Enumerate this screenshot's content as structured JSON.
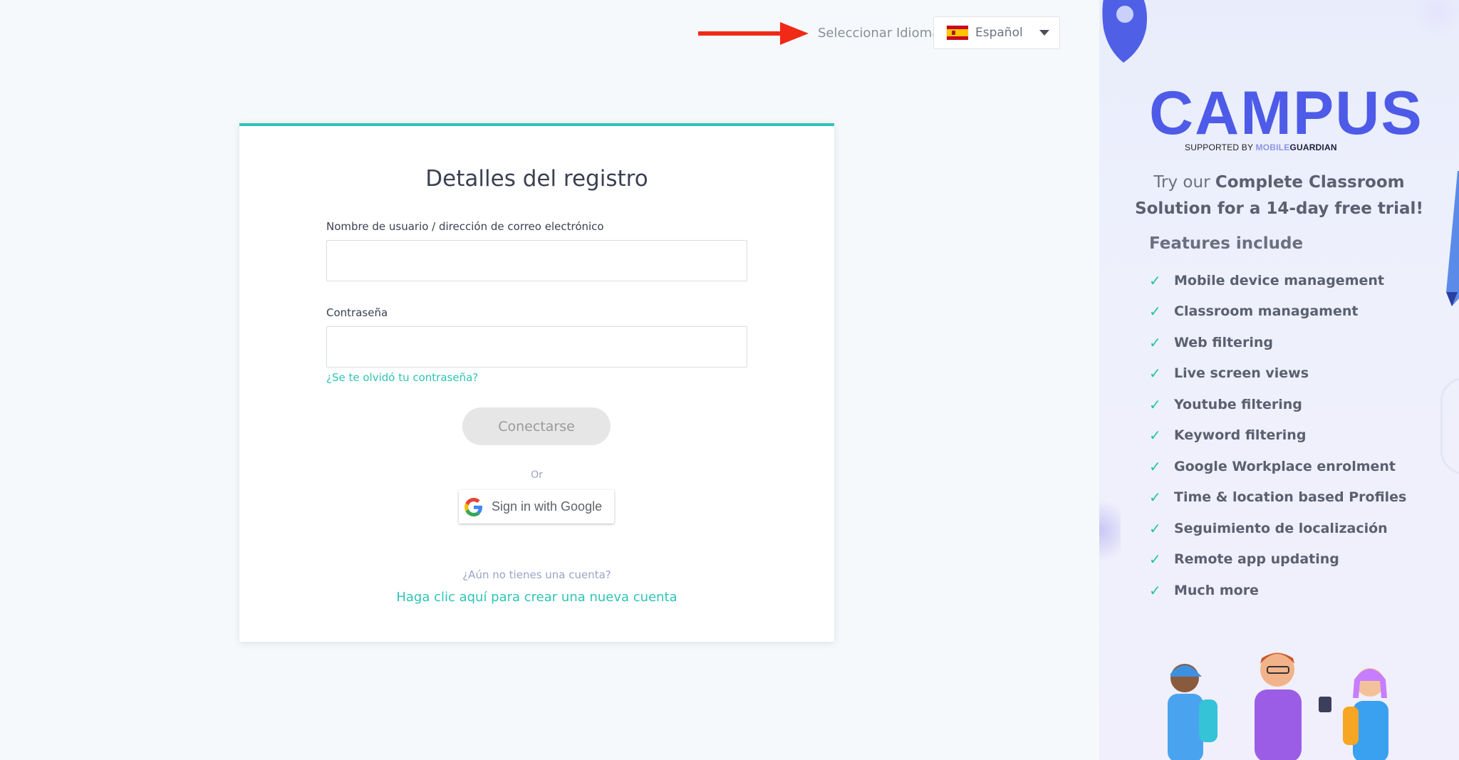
{
  "language": {
    "label": "Seleccionar Idioma",
    "selected": "Español",
    "flag_icon": "spain-flag-icon"
  },
  "login": {
    "title": "Detalles del registro",
    "username_label": "Nombre de usuario / dirección de correo electrónico",
    "username_value": "",
    "password_label": "Contraseña",
    "password_value": "",
    "forgot_password": "¿Se te olvidó tu contraseña?",
    "connect_button": "Conectarse",
    "or_text": "Or",
    "google_button": "Sign in with Google",
    "no_account": "¿Aún no tienes una cuenta?",
    "create_account": "Haga clic aquí para crear una nueva cuenta"
  },
  "promo": {
    "logo": "CAMPUS",
    "supported_by": "SUPPORTED BY",
    "brand_part1": "MOBILE",
    "brand_part2": "GUARDIAN",
    "trial_pre": "Try our ",
    "trial_bold": "Complete Classroom Solution for a 14-day free trial!",
    "features_heading": "Features include",
    "features": [
      "Mobile device management",
      "Classroom managament",
      "Web filtering",
      "Live screen views",
      "Youtube filtering",
      "Keyword filtering",
      "Google Workplace enrolment",
      "Time & location based Profiles",
      "Seguimiento de localización",
      "Remote app updating",
      "Much more"
    ]
  },
  "colors": {
    "accent_teal": "#2ec4b6",
    "brand_blue": "#4d5be8",
    "annotation_red": "#f02a16"
  }
}
